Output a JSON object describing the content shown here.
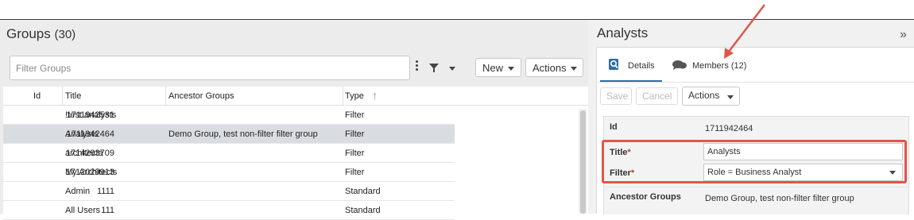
{
  "groups": {
    "title": "Groups",
    "count": "(30)",
    "filter_placeholder": "Filter Groups",
    "buttons": {
      "new": "New",
      "actions": "Actions"
    },
    "columns": [
      "Id",
      "Title",
      "Ancestor Groups",
      "Type"
    ],
    "rows": [
      {
        "id": "1711942531",
        "title": "!test analysts",
        "ancestor": "",
        "type": "Filter",
        "selected": false
      },
      {
        "id": "1711942464",
        "title": "Analysts",
        "ancestor": "Demo Group, test non-filter filter group",
        "type": "Filter",
        "selected": true
      },
      {
        "id": "1714293709",
        "title": "architecta",
        "ancestor": "",
        "type": "Filter",
        "selected": false
      },
      {
        "id": "1712029913",
        "title": "My Architects",
        "ancestor": "",
        "type": "Filter",
        "selected": false
      },
      {
        "id": "1111",
        "title": "Admin",
        "ancestor": "",
        "type": "Standard",
        "selected": false
      },
      {
        "id": "111",
        "title": "All Users",
        "ancestor": "",
        "type": "Standard",
        "selected": false
      }
    ]
  },
  "detail": {
    "title": "Analysts",
    "collapse_glyph": "»",
    "tabs": {
      "details": "Details",
      "members": "Members (12)"
    },
    "buttons": {
      "save": "Save",
      "cancel": "Cancel",
      "actions": "Actions"
    },
    "fields": {
      "id_label": "Id",
      "id_value": "1711942464",
      "title_label": "Title",
      "title_value": "Analysts",
      "filter_label": "Filter",
      "filter_value": "Role = Business Analyst",
      "ancestor_label": "Ancestor Groups",
      "ancestor_value": "Demo Group, test non-filter filter group",
      "required_mark": "*"
    }
  },
  "colors": {
    "accent": "#2f6ea3",
    "highlight": "#e0564a",
    "selected_row": "#d9dde2",
    "required": "#c0392b"
  }
}
